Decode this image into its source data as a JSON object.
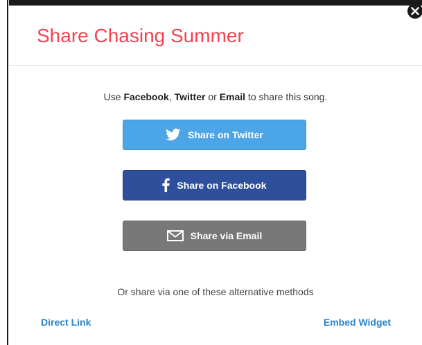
{
  "modal": {
    "title": "Share Chasing Summer",
    "close_icon": "close-circle-icon",
    "instructions": {
      "prefix": "Use ",
      "facebook": "Facebook",
      "sep1": ", ",
      "twitter": "Twitter",
      "sep2": " or ",
      "email": "Email",
      "suffix": " to share this song."
    },
    "buttons": {
      "twitter": {
        "label": "Share on Twitter",
        "icon": "twitter-icon",
        "color": "#4ca5e6"
      },
      "facebook": {
        "label": "Share on Facebook",
        "icon": "facebook-icon",
        "color": "#2e4f9c"
      },
      "email": {
        "label": "Share via Email",
        "icon": "email-icon",
        "color": "#787878"
      }
    },
    "alternative_text": "Or share via one of these alternative methods",
    "links": {
      "direct": "Direct Link",
      "embed": "Embed Widget"
    },
    "title_color": "#f4424f",
    "link_color": "#2a82c9"
  }
}
